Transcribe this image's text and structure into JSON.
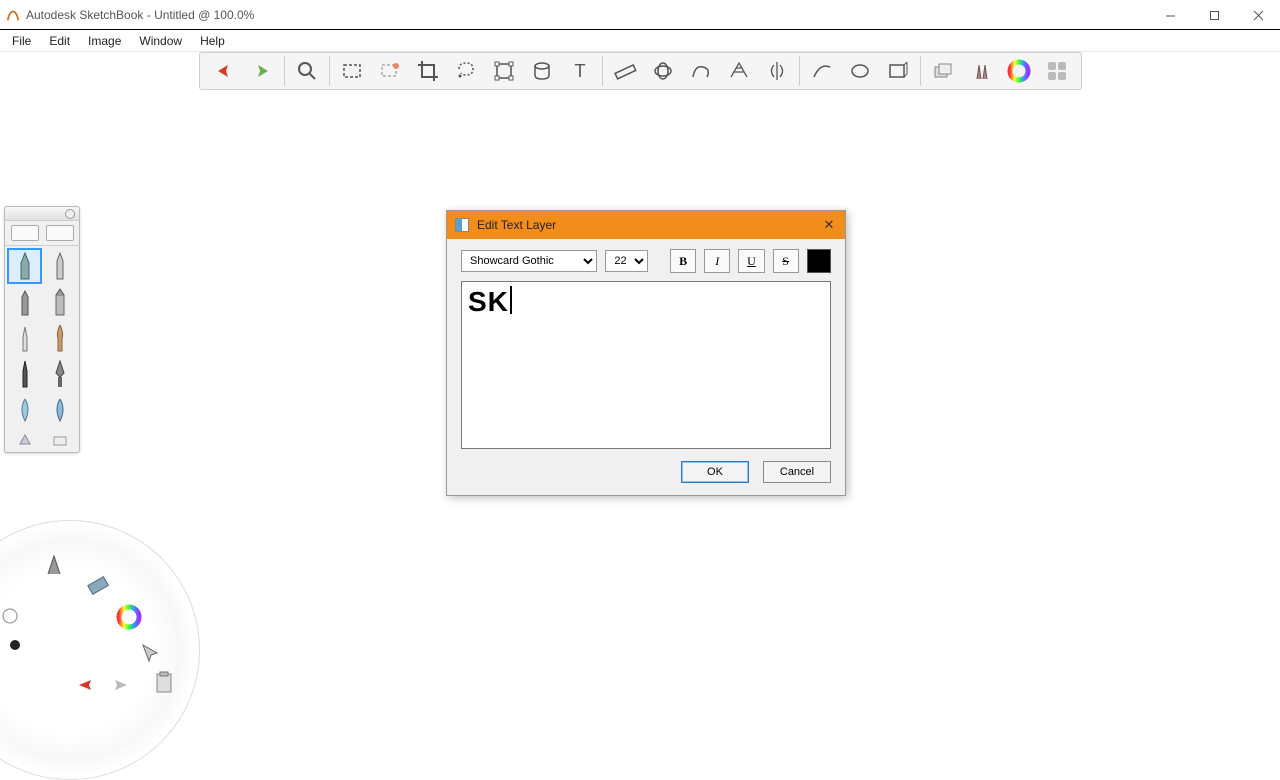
{
  "window": {
    "title": "Autodesk SketchBook - Untitled @ 100.0%",
    "minimize": "—",
    "maximize": "▢",
    "close": "✕"
  },
  "menu": {
    "file": "File",
    "edit": "Edit",
    "image": "Image",
    "window": "Window",
    "help": "Help"
  },
  "toolbar_icons": {
    "undo": "undo",
    "redo": "redo",
    "zoom": "zoom",
    "select_rect": "select-rect",
    "select_add": "select-add",
    "crop": "crop",
    "lasso": "lasso",
    "shape": "shape",
    "bucket": "bucket",
    "text": "text",
    "ruler": "ruler",
    "ellipse_guide": "ellipse-guide",
    "curve_guide": "curve-guide",
    "perspective": "perspective",
    "symmetry": "symmetry",
    "line": "line",
    "ellipse": "ellipse",
    "rect": "rect",
    "layers": "layers",
    "brushes": "brushes",
    "color": "color",
    "apps": "apps"
  },
  "brush_tools": [
    "pencil",
    "pen",
    "marker",
    "chisel",
    "airbrush",
    "brush",
    "ink",
    "nib",
    "paint",
    "smudge",
    "eraser-soft",
    "eraser-hard"
  ],
  "dialog": {
    "title": "Edit Text Layer",
    "font": "Showcard Gothic",
    "size": "22",
    "bold": "B",
    "italic": "I",
    "underline": "U",
    "strike": "S",
    "text_value": "SK",
    "ok": "OK",
    "cancel": "Cancel",
    "close": "✕"
  }
}
